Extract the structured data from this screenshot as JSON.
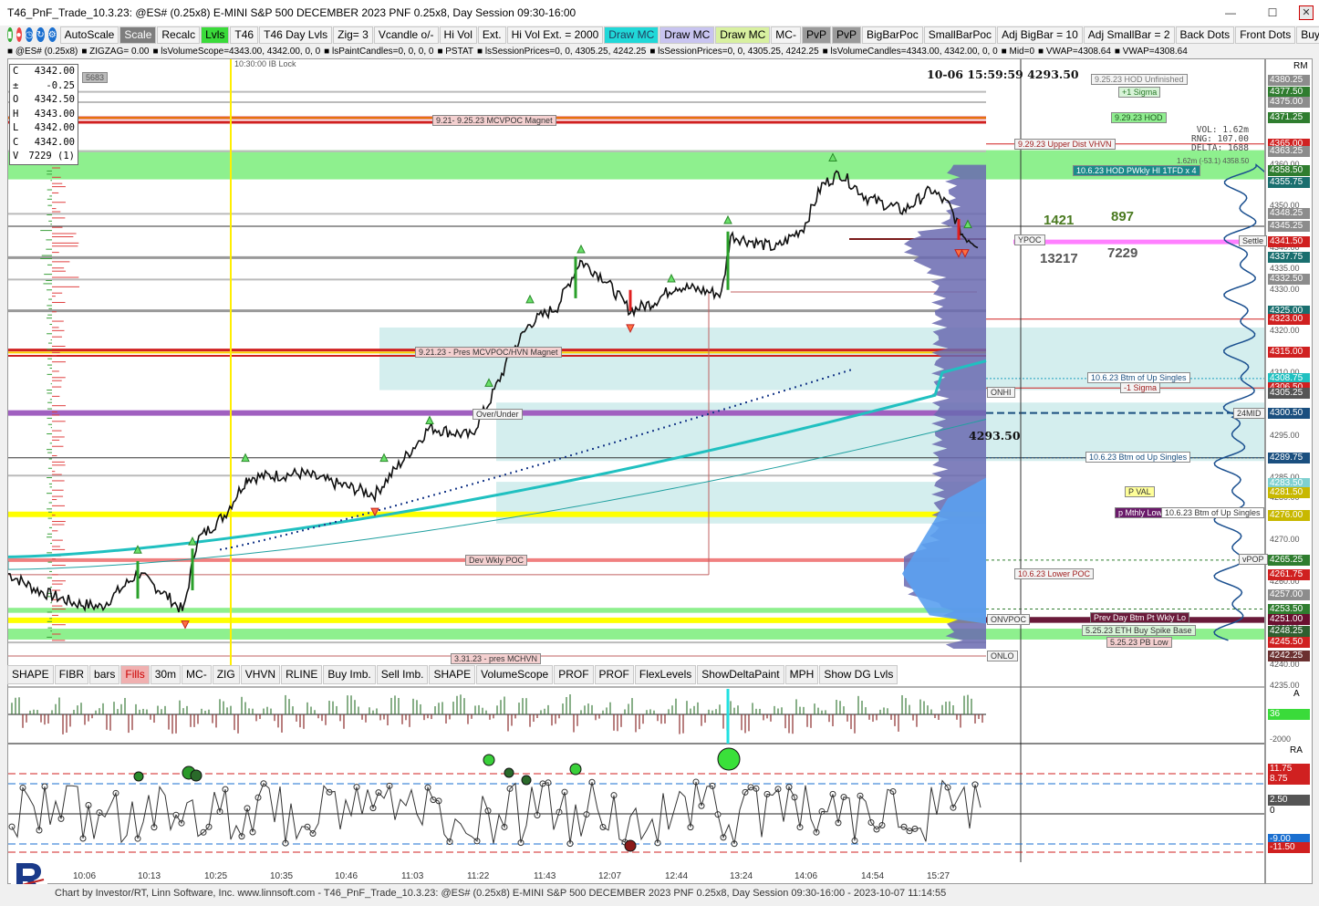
{
  "window": {
    "title": "T46_PnF_Trade_10.3.23: @ES# (0.25x8) E-MINI S&P 500 DECEMBER 2023 PNF 0.25x8, Day Session 09:30-16:00",
    "minimize": "—",
    "maximize": "☐",
    "close": "✕"
  },
  "toolbar": [
    {
      "label": "AutoScale",
      "style": ""
    },
    {
      "label": "Scale",
      "style": "dark"
    },
    {
      "label": "Recalc",
      "style": ""
    },
    {
      "label": "Lvls",
      "style": "green"
    },
    {
      "label": "T46",
      "style": ""
    },
    {
      "label": "T46 Day Lvls",
      "style": ""
    },
    {
      "label": "Zig= 3",
      "style": ""
    },
    {
      "label": "Vcandle o/-",
      "style": ""
    },
    {
      "label": "Hi Vol",
      "style": ""
    },
    {
      "label": "Ext.",
      "style": ""
    },
    {
      "label": "Hi Vol Ext. = 2000",
      "style": ""
    },
    {
      "label": "Draw MC",
      "style": "cyan"
    },
    {
      "label": "Draw MC",
      "style": "lav"
    },
    {
      "label": "Draw MC",
      "style": "lime"
    },
    {
      "label": "MC-",
      "style": ""
    },
    {
      "label": "PvP",
      "style": "gray"
    },
    {
      "label": "PvP",
      "style": "gray"
    },
    {
      "label": "BigBarPoc",
      "style": ""
    },
    {
      "label": "SmallBarPoc",
      "style": ""
    },
    {
      "label": "Adj BigBar = 10",
      "style": ""
    },
    {
      "label": "Adj SmallBar = 2",
      "style": ""
    },
    {
      "label": "Back Dots",
      "style": ""
    },
    {
      "label": "Front Dots",
      "style": ""
    },
    {
      "label": "Buy",
      "style": ""
    }
  ],
  "indicator_strip": [
    "@ES# (0.25x8)",
    "ZIGZAG= 0.00",
    "lsVolumeScope=4343.00, 4342.00, 0, 0",
    "lsPaintCandles=0, 0, 0, 0",
    "PSTAT",
    "lsSessionPrices=0, 0, 4305.25, 4242.25",
    "lsSessionPrices=0, 0, 4305.25, 4242.25",
    "lsVolumeCandles=4343.00, 4342.00, 0, 0",
    "Mid=0",
    "VWAP=4308.64",
    "VWAP=4308.64"
  ],
  "ohlc": [
    {
      "k": "C",
      "v": "4342.00"
    },
    {
      "k": "±",
      "v": "-0.25"
    },
    {
      "k": "O",
      "v": "4342.50"
    },
    {
      "k": "H",
      "v": "4343.00"
    },
    {
      "k": "L",
      "v": "4342.00"
    },
    {
      "k": "C",
      "v": "4342.00"
    },
    {
      "k": "V",
      "v": "7229 (1)"
    }
  ],
  "ib_lock": "10:30:00 IB Lock",
  "stamp": "10-06 15:59:59  4293.50",
  "stamp2": "4293.50",
  "left_tag": "5683",
  "stats": {
    "vol": "VOL: 1.62m",
    "rng": "RNG: 107.00",
    "delta": "DELTA: 1688",
    "mini": "1.62m (-53.1)  4358.50"
  },
  "vol_numbers": {
    "a": "1421",
    "b": "897",
    "c": "13217",
    "d": "7229"
  },
  "chart_toolbar": [
    {
      "label": "SHAPE",
      "style": ""
    },
    {
      "label": "FIBR",
      "style": ""
    },
    {
      "label": "bars",
      "style": ""
    },
    {
      "label": "Fills",
      "style": "red"
    },
    {
      "label": "30m",
      "style": ""
    },
    {
      "label": "MC-",
      "style": ""
    },
    {
      "label": "ZIG",
      "style": ""
    },
    {
      "label": "VHVN",
      "style": ""
    },
    {
      "label": "RLINE",
      "style": ""
    },
    {
      "label": "Buy Imb.",
      "style": ""
    },
    {
      "label": "Sell Imb.",
      "style": ""
    },
    {
      "label": "SHAPE",
      "style": ""
    },
    {
      "label": "VolumeScope",
      "style": ""
    },
    {
      "label": "PROF",
      "style": ""
    },
    {
      "label": "PROF",
      "style": ""
    },
    {
      "label": "FlexLevels",
      "style": ""
    },
    {
      "label": "ShowDeltaPaint",
      "style": ""
    },
    {
      "label": "MPH",
      "style": ""
    },
    {
      "label": "Show DG Lvls",
      "style": ""
    }
  ],
  "level_labels": [
    {
      "text": "9.21- 9.25.23 MCVPOC Magnet"
    },
    {
      "text": "9.21.23 - Pres MCVPOC/HVN Magnet"
    },
    {
      "text": "Over/Under"
    },
    {
      "text": "Dev Wkly POC"
    },
    {
      "text": "3.31.23 - pres MCHVN"
    },
    {
      "text": "9.25.23 HOD Unfinished"
    },
    {
      "text": "+1 Sigma"
    },
    {
      "text": "9.29.23 HOD"
    },
    {
      "text": "9.29.23 Upper Dist VHVN"
    },
    {
      "text": "10.6.23 HOD PWkly HI 1TFD x 4"
    },
    {
      "text": "YPOC"
    },
    {
      "text": "Settle"
    },
    {
      "text": "10.6.23 Btm of Up Singles"
    },
    {
      "text": "ONHI"
    },
    {
      "text": "-1 Sigma"
    },
    {
      "text": "24MID"
    },
    {
      "text": "10.6.23 Btm od Up Singles"
    },
    {
      "text": "P VAL"
    },
    {
      "text": "p Mthly Low"
    },
    {
      "text": "10.6.23 Btm of Up Singles"
    },
    {
      "text": "vPOP"
    },
    {
      "text": "10.6.23 Lower POC"
    },
    {
      "text": "ONVPOC"
    },
    {
      "text": "Prev Day Btm Pt Wkly Lo"
    },
    {
      "text": "5.25.23 ETH Buy Spike Base"
    },
    {
      "text": "5.25.23 PB Low"
    },
    {
      "text": "ONLO"
    }
  ],
  "right_axis_labels": [
    {
      "v": "4380.25",
      "c": "#8c8c8c"
    },
    {
      "v": "4377.50",
      "c": "#2f7d2f"
    },
    {
      "v": "4375.00",
      "c": "#8c8c8c"
    },
    {
      "v": "4371.25",
      "c": "#2f7d2f"
    },
    {
      "v": "4365.00",
      "c": "#d02020"
    },
    {
      "v": "4363.25",
      "c": "#8c8c8c"
    },
    {
      "v": "4358.50",
      "c": "#2f7d2f"
    },
    {
      "v": "4355.75",
      "c": "#1a6f6f"
    },
    {
      "v": "4348.25",
      "c": "#8c8c8c"
    },
    {
      "v": "4345.25",
      "c": "#8c8c8c"
    },
    {
      "v": "4341.50",
      "c": "#d02020"
    },
    {
      "v": "4337.75",
      "c": "#1a6f6f"
    },
    {
      "v": "4332.50",
      "c": "#8c8c8c"
    },
    {
      "v": "4325.00",
      "c": "#1a6f6f"
    },
    {
      "v": "4323.00",
      "c": "#d02020"
    },
    {
      "v": "4315.00",
      "c": "#d02020"
    },
    {
      "v": "4308.75",
      "c": "#20c0c0"
    },
    {
      "v": "4306.50",
      "c": "#d02020"
    },
    {
      "v": "4305.25",
      "c": "#555555"
    },
    {
      "v": "4300.50",
      "c": "#1a4f7f"
    },
    {
      "v": "4289.75",
      "c": "#1a4f7f"
    },
    {
      "v": "4283.50",
      "c": "#7fd0d0"
    },
    {
      "v": "4281.50",
      "c": "#c8b800"
    },
    {
      "v": "4276.00",
      "c": "#c8b800"
    },
    {
      "v": "4265.25",
      "c": "#2f7d2f"
    },
    {
      "v": "4261.75",
      "c": "#d02020"
    },
    {
      "v": "4257.00",
      "c": "#8c8c8c"
    },
    {
      "v": "4253.50",
      "c": "#2f7d2f"
    },
    {
      "v": "4251.00",
      "c": "#6b1030"
    },
    {
      "v": "4248.25",
      "c": "#2f5f2f"
    },
    {
      "v": "4245.50",
      "c": "#d02020"
    },
    {
      "v": "4242.25",
      "c": "#6b3030"
    }
  ],
  "axis_ticks": [
    "4360.00",
    "4350.00",
    "4340.00",
    "4335.00",
    "4330.00",
    "4320.00",
    "4310.00",
    "4300.00",
    "4295.00",
    "4285.00",
    "4280.00",
    "4270.00",
    "4260.00",
    "4250.00",
    "4240.00",
    "4235.00"
  ],
  "delta_panel": {
    "label": "A",
    "value": "36",
    "neg": "-2000"
  },
  "ra_panel": {
    "label": "RA",
    "values": [
      "11.75",
      "8.75",
      "2.50",
      "0",
      "-9.00",
      "-11.50"
    ]
  },
  "rm_label": "RM",
  "time_ticks": [
    "10:06",
    "10:13",
    "10:25",
    "10:35",
    "10:46",
    "11:03",
    "11:22",
    "11:43",
    "12:07",
    "12:44",
    "13:24",
    "14:06",
    "14:54",
    "15:27"
  ],
  "status": "Chart by Investor/RT, Linn Software, Inc. www.linnsoft.com - T46_PnF_Trade_10.3.23: @ES# (0.25x8) E-MINI S&P 500 DECEMBER 2023 PNF 0.25x8, Day Session 09:30-16:00 - 2023-10-07 11:14:55"
}
